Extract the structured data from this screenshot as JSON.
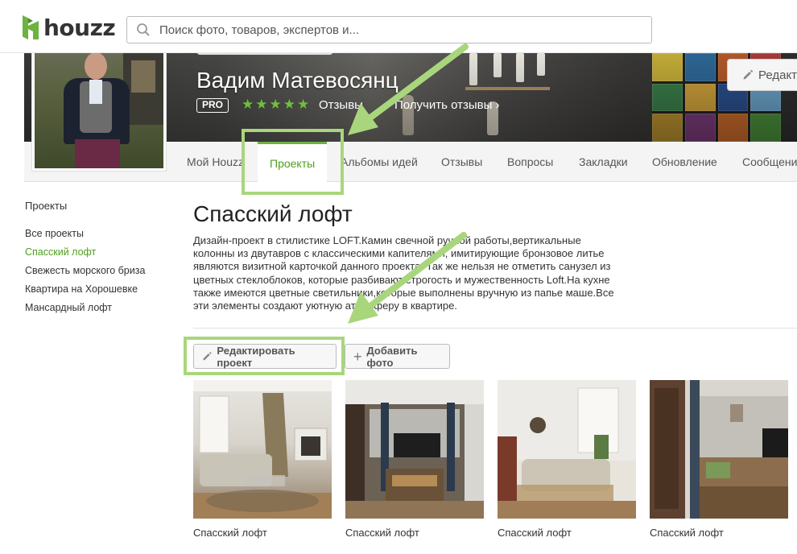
{
  "header": {
    "logo_text": "houzz",
    "search_placeholder": "Поиск фото, товаров, экспертов и..."
  },
  "profile": {
    "name": "Вадим Матевосянц",
    "badge": "PRO",
    "rating_stars": 5,
    "reviews_label": "Отзывы",
    "get_reviews_label": "Получить отзывы ›",
    "edit_label": "Редакт"
  },
  "tabs": [
    {
      "label": "Мой Houzz"
    },
    {
      "label": "Проекты",
      "active": true
    },
    {
      "label": "Альбомы идей"
    },
    {
      "label": "Отзывы"
    },
    {
      "label": "Вопросы"
    },
    {
      "label": "Закладки"
    },
    {
      "label": "Обновление"
    },
    {
      "label": "Сообщени"
    }
  ],
  "sidebar": {
    "title": "Проекты",
    "items": [
      {
        "label": "Все проекты"
      },
      {
        "label": "Спасский лофт",
        "active": true
      },
      {
        "label": "Свежесть морского бриза"
      },
      {
        "label": "Квартира на Хорошевке"
      },
      {
        "label": "Мансардный лофт"
      }
    ]
  },
  "project": {
    "title": "Спасский лофт",
    "description": "Дизайн-проект в стилистике LOFT.Камин свечной ручной работы,вертикальные колонны из двутавров с классическими капителями, имитирующие бронзовое литье являются визитной карточкой данного проекта. Так же нельзя не отметить санузел из цветных стеклоблоков, которые разбивают строгость и мужественность Loft.На кухне также имеются цветные светильники,которые выполнены вручную из папье маше.Все эти элементы создают уютную атмосферу в квартире.",
    "edit_button": "Редактировать проект",
    "add_photo_button": "Добавить фото"
  },
  "photos": [
    {
      "caption": "Спасский лофт"
    },
    {
      "caption": "Спасский лофт"
    },
    {
      "caption": "Спасский лофт"
    },
    {
      "caption": "Спасский лофт"
    }
  ],
  "colors": {
    "brand_green": "#6cb33f",
    "annotation_green": "#a9d67c"
  }
}
